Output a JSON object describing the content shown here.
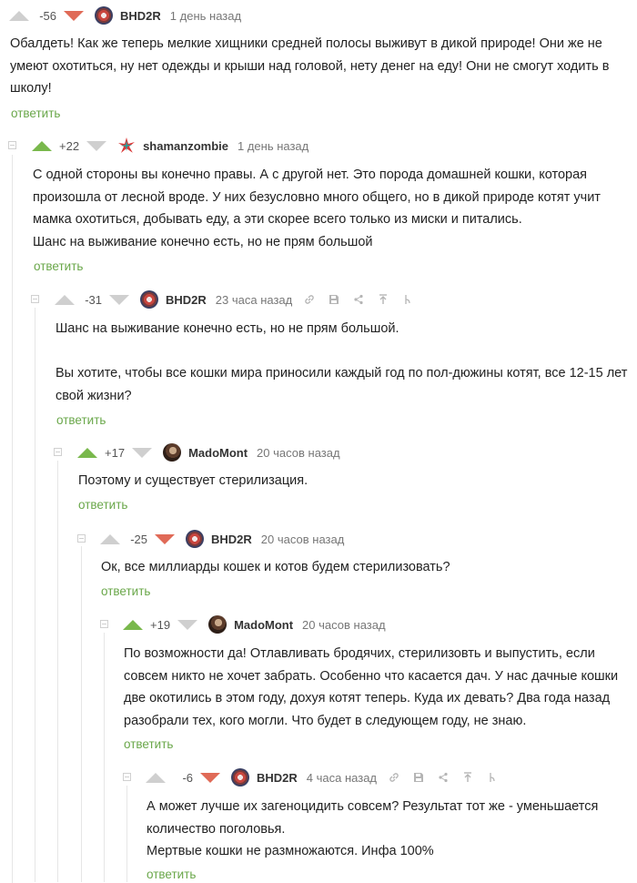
{
  "comments": [
    {
      "rating": "-56",
      "author": "BHD2R",
      "time": "1 день назад",
      "text": [
        "Обалдеть! Как же теперь мелкие хищники средней полосы выживут в дикой природе! Они же не умеют охотиться, ну нет одежды и крыши над головой, нету денег на еду! Они не смогут ходить в школу!"
      ],
      "reply": "ответить"
    },
    {
      "rating": "+22",
      "author": "shamanzombie",
      "time": "1 день назад",
      "text": [
        "С одной стороны вы конечно правы. А с другой нет. Это порода домашней кошки, которая произошла от лесной вроде. У них безусловно много общего, но в дикой природе котят учит мамка охотиться, добывать еду, а эти скорее всего только из миски и питались.",
        "Шанс на выживание конечно есть, но не прям большой"
      ],
      "reply": "ответить"
    },
    {
      "rating": "-31",
      "author": "BHD2R",
      "time": "23 часа назад",
      "text": [
        "Шанс на выживание конечно есть, но не прям большой.",
        "",
        "Вы хотите, чтобы все кошки мира приносили каждый год по пол-дюжины котят, все 12-15 лет свой жизни?"
      ],
      "reply": "ответить"
    },
    {
      "rating": "+17",
      "author": "MadoMont",
      "time": "20 часов назад",
      "text": [
        "Поэтому и существует стерилизация."
      ],
      "reply": "ответить"
    },
    {
      "rating": "-25",
      "author": "BHD2R",
      "time": "20 часов назад",
      "text": [
        "Ок, все миллиарды кошек и котов будем стерилизовать?"
      ],
      "reply": "ответить"
    },
    {
      "rating": "+19",
      "author": "MadoMont",
      "time": "20 часов назад",
      "text": [
        "По возможности да! Отлавливать бродячих, стерилизовть и выпустить, если совсем никто не хочет забрать. Особенно что касается дач. У нас дачные кошки две окотились в этом году, дохуя котят теперь. Куда их девать? Два года назад разобрали тех, кого могли. Что будет в следующем году, не знаю."
      ],
      "reply": "ответить"
    },
    {
      "rating": "-6",
      "author": "BHD2R",
      "time": "4 часа назад",
      "text": [
        "А может лучше их загеноцидить совсем? Результат тот же - уменьшается количество поголовья.",
        "Мертвые кошки не размножаются. Инфа 100%"
      ],
      "reply": "ответить"
    }
  ],
  "icons": {
    "link": "link-icon",
    "save": "save-icon",
    "share": "share-icon",
    "parent": "go-to-parent-icon",
    "branch": "branch-icon"
  },
  "colors": {
    "upvote_active": "#79b84c",
    "downvote_active": "#e06a57",
    "reply_link": "#6aa74a",
    "inactive_vote": "#cfcfcf"
  }
}
